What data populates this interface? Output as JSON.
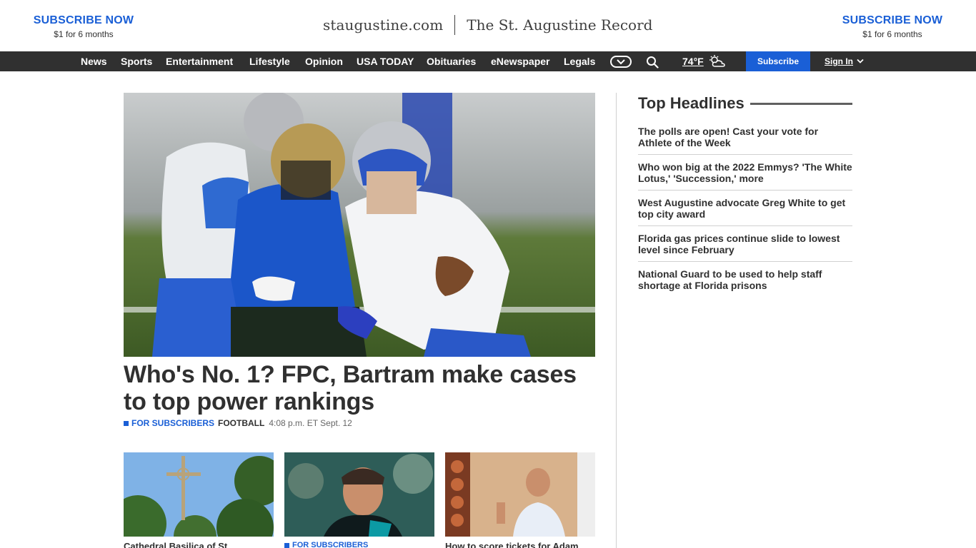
{
  "masthead": {
    "subscribe_left": {
      "title": "SUBSCRIBE NOW",
      "price": "$1 for 6 months"
    },
    "subscribe_right": {
      "title": "SUBSCRIBE NOW",
      "price": "$1 for 6 months"
    },
    "site_name": "staugustine.com",
    "paper_name": "The St. Augustine Record"
  },
  "nav": {
    "items": [
      "News",
      "Sports",
      "Entertainment",
      "Lifestyle",
      "Opinion",
      "USA TODAY",
      "Obituaries",
      "eNewspaper",
      "Legals"
    ],
    "temperature": "74°F",
    "subscribe_label": "Subscribe",
    "signin_label": "Sign In"
  },
  "hero": {
    "title": "Who's No. 1? FPC, Bartram make cases to top power rankings",
    "badge": "FOR SUBSCRIBERS",
    "category": "FOOTBALL",
    "timestamp": "4:08 p.m. ET Sept. 12"
  },
  "top_headlines": {
    "title": "Top Headlines",
    "items": [
      "The polls are open! Cast your vote for Athlete of the Week",
      "Who won big at the 2022 Emmys? 'The White Lotus,' 'Succession,' more",
      "West Augustine advocate Greg White to get top city award",
      "Florida gas prices continue slide to lowest level since February",
      "National Guard to be used to help staff shortage at Florida prisons"
    ]
  },
  "cards": [
    {
      "caption": "Cathedral Basilica of St"
    },
    {
      "caption": "FOR SUBSCRIBERS"
    },
    {
      "caption": "How to score tickets for Adam"
    }
  ],
  "colors": {
    "accent": "#1a5fd6",
    "nav_bg": "#303030",
    "text": "#303030"
  }
}
